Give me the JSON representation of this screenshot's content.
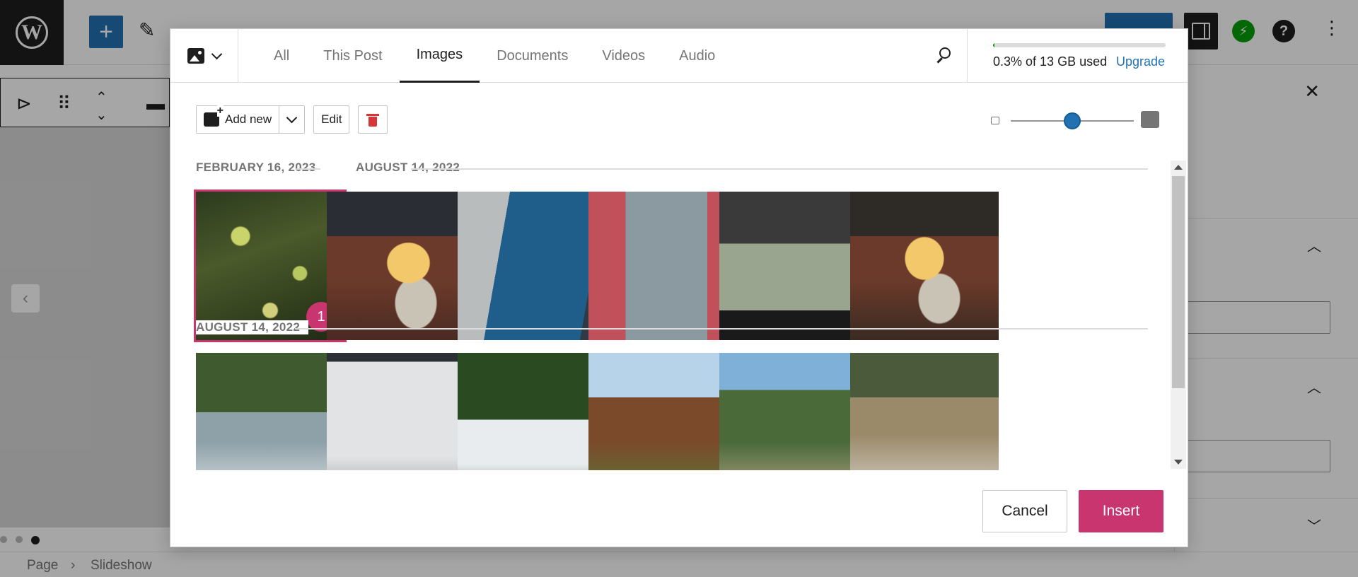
{
  "editor": {
    "breadcrumb": [
      "Page",
      "Slideshow"
    ],
    "breadcrumb_sep": "›"
  },
  "modal": {
    "tabs": [
      {
        "label": "All",
        "active": false
      },
      {
        "label": "This Post",
        "active": false
      },
      {
        "label": "Images",
        "active": true
      },
      {
        "label": "Documents",
        "active": false
      },
      {
        "label": "Videos",
        "active": false
      },
      {
        "label": "Audio",
        "active": false
      }
    ],
    "storage": {
      "text": "0.3% of 13 GB used",
      "upgrade_label": "Upgrade",
      "used_fraction": 0.003
    },
    "toolbar": {
      "add_new_label": "Add new",
      "edit_label": "Edit"
    },
    "zoom_level": 0.5,
    "groups": [
      {
        "dates": [
          "FEBRUARY 16, 2023",
          "AUGUST 14, 2022"
        ],
        "images": [
          {
            "name": "tree-branches",
            "selected": true,
            "order": "1"
          },
          {
            "name": "dessert-plate"
          },
          {
            "name": "blue-building-sign"
          },
          {
            "name": "street-view-pink-wall"
          },
          {
            "name": "market-stall-jade"
          },
          {
            "name": "dessert-plate-2"
          }
        ]
      },
      {
        "dates": [
          "AUGUST 14, 2022"
        ],
        "images": [
          {
            "name": "waterfall-trees"
          },
          {
            "name": "cloudy-sky"
          },
          {
            "name": "waterfall-forest"
          },
          {
            "name": "temple-building"
          },
          {
            "name": "rock-cliff"
          },
          {
            "name": "rainbow-falls"
          }
        ]
      }
    ],
    "footer": {
      "cancel_label": "Cancel",
      "insert_label": "Insert"
    }
  },
  "colors": {
    "accent": "#c9356e",
    "link": "#2271b1",
    "storage_bar": "#069e08"
  }
}
